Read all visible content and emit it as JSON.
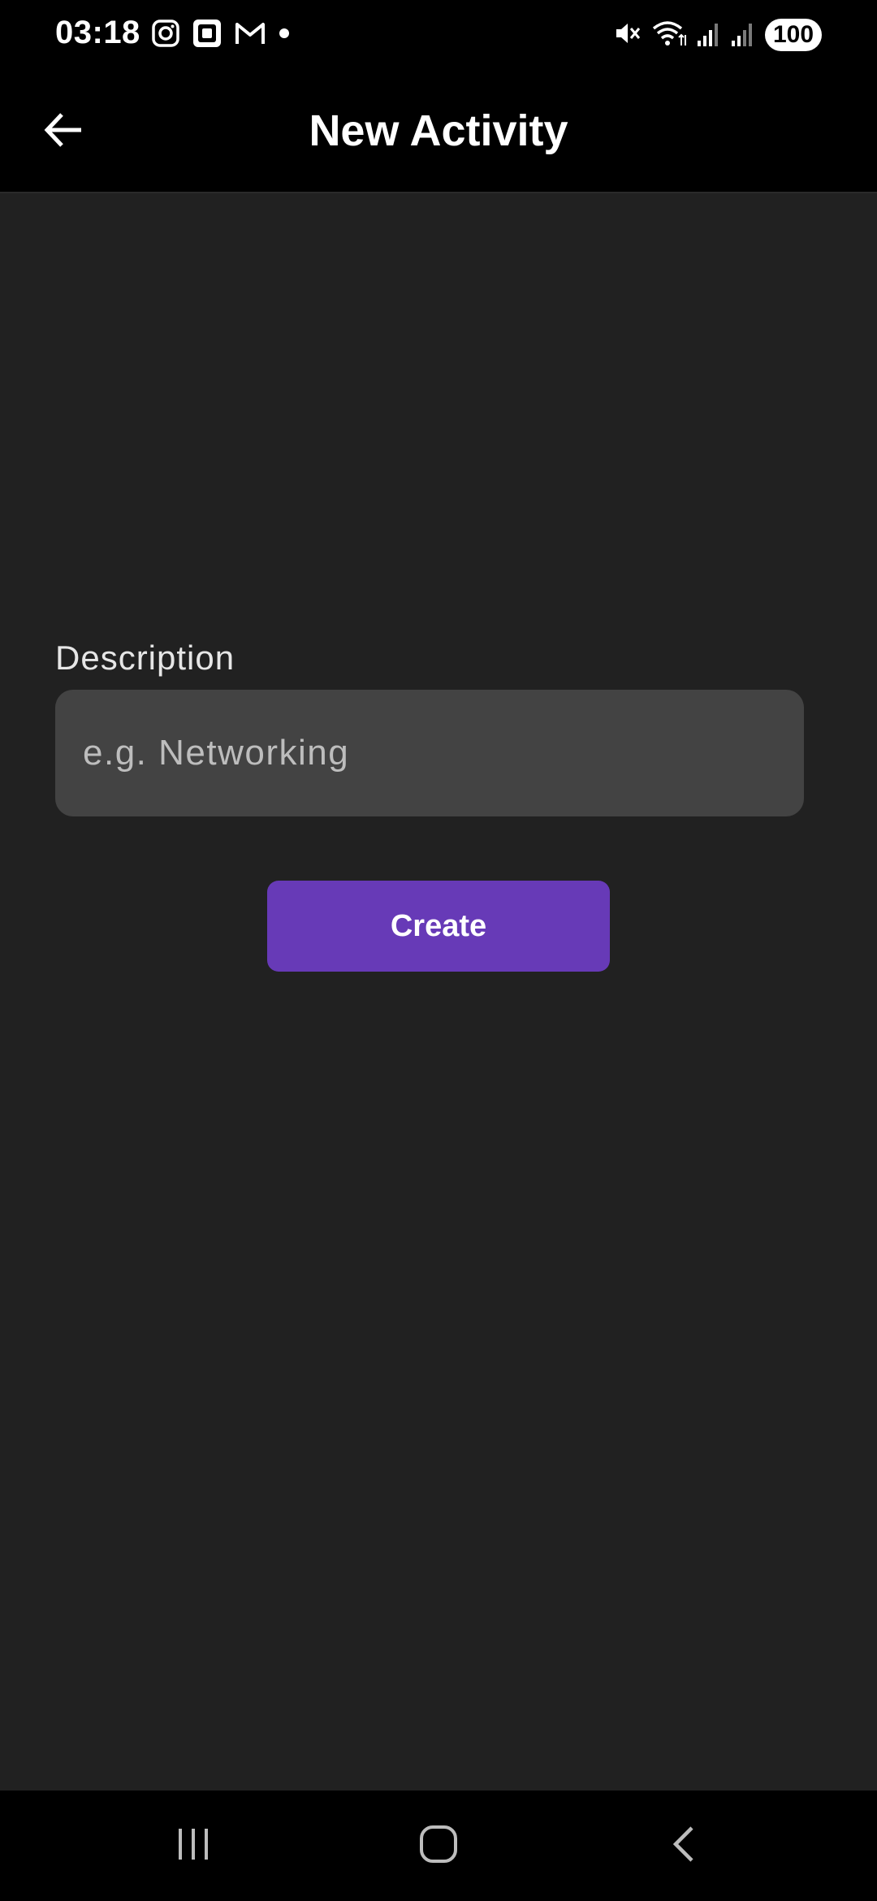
{
  "status_bar": {
    "time": "03:18",
    "battery": "100",
    "left_icons": [
      "instagram-icon",
      "screen-capture-icon",
      "gmail-icon",
      "notification-dot-icon"
    ],
    "right_icons": [
      "mute-icon",
      "wifi-icon",
      "signal-icon",
      "signal-icon"
    ]
  },
  "app_bar": {
    "title": "New Activity",
    "back_icon": "arrow-left-icon"
  },
  "form": {
    "description_label": "Description",
    "description_placeholder": "e.g. Networking",
    "description_value": "",
    "create_label": "Create"
  },
  "nav_bar": {
    "icons": [
      "recent-apps-icon",
      "home-icon",
      "back-icon"
    ]
  },
  "colors": {
    "background": "#212121",
    "bar": "#000000",
    "input": "#434343",
    "accent": "#673ab7"
  }
}
